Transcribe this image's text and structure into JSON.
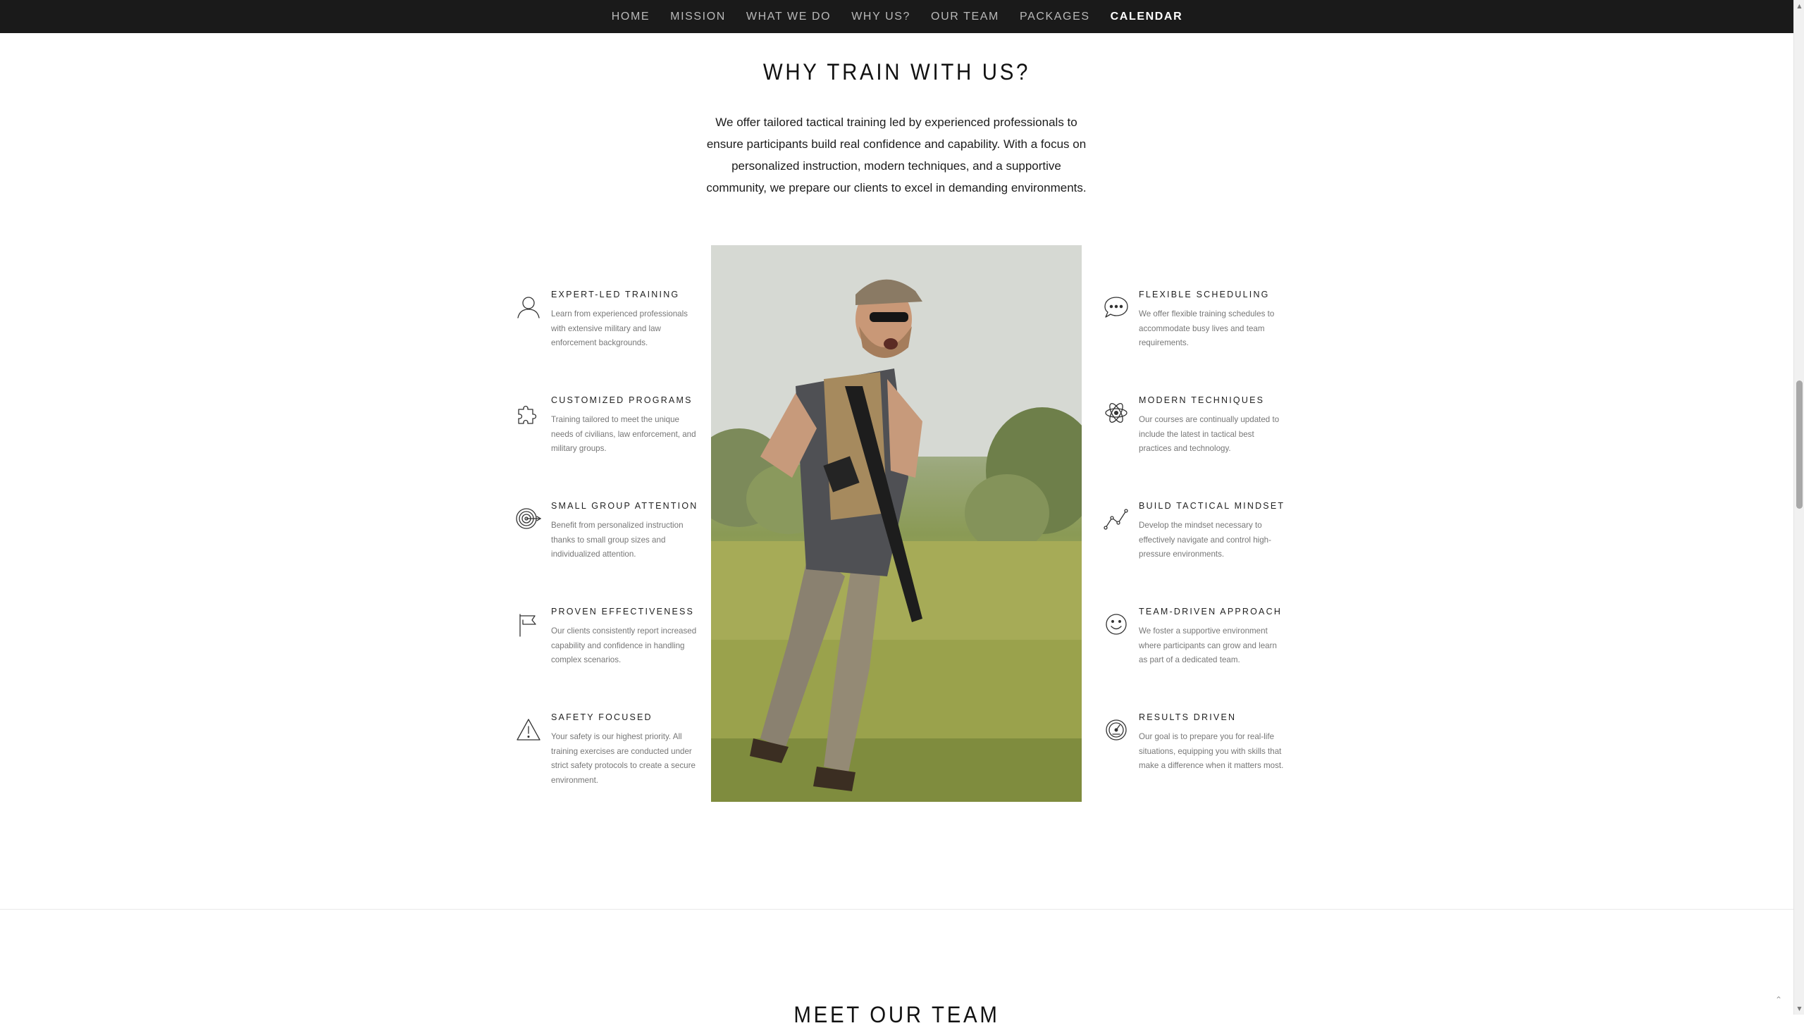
{
  "nav": {
    "items": [
      {
        "label": "HOME"
      },
      {
        "label": "MISSION"
      },
      {
        "label": "WHAT WE DO"
      },
      {
        "label": "WHY US?"
      },
      {
        "label": "OUR TEAM"
      },
      {
        "label": "PACKAGES"
      },
      {
        "label": "CALENDAR"
      }
    ],
    "active": "CALENDAR"
  },
  "why": {
    "title": "WHY TRAIN WITH US?",
    "intro": "We offer tailored tactical training led by experienced professionals to ensure participants build real confidence and capability. With a focus on personalized instruction, modern techniques, and a supportive community, we prepare our clients to excel in demanding environments."
  },
  "features_left": [
    {
      "icon": "user-icon",
      "title": "EXPERT-LED TRAINING",
      "text": "Learn from experienced professionals with extensive military and law enforcement backgrounds."
    },
    {
      "icon": "puzzle-icon",
      "title": "CUSTOMIZED PROGRAMS",
      "text": "Training tailored to meet the unique needs of civilians, law enforcement, and military groups."
    },
    {
      "icon": "target-icon",
      "title": "SMALL GROUP ATTENTION",
      "text": "Benefit from personalized instruction thanks to small group sizes and individualized attention."
    },
    {
      "icon": "flag-icon",
      "title": "PROVEN EFFECTIVENESS",
      "text": "Our clients consistently report increased capability and confidence in handling complex scenarios."
    },
    {
      "icon": "warning-icon",
      "title": "SAFETY FOCUSED",
      "text": "Your safety is our highest priority. All training exercises are conducted under strict safety protocols to create a secure environment."
    }
  ],
  "features_right": [
    {
      "icon": "chat-bubble-icon",
      "title": "FLEXIBLE SCHEDULING",
      "text": "We offer flexible training schedules to accommodate busy lives and team requirements."
    },
    {
      "icon": "atom-icon",
      "title": "MODERN TECHNIQUES",
      "text": "Our courses are continually updated to include the latest in tactical best practices and technology."
    },
    {
      "icon": "trend-line-icon",
      "title": "BUILD TACTICAL MINDSET",
      "text": "Develop the mindset necessary to effectively navigate and control high-pressure environments."
    },
    {
      "icon": "smiley-icon",
      "title": "TEAM-DRIVEN APPROACH",
      "text": "We foster a supportive environment where participants can grow and learn as part of a dedicated team."
    },
    {
      "icon": "speedometer-icon",
      "title": "RESULTS DRIVEN",
      "text": "Our goal is to prepare you for real-life situations, equipping you with skills that make a difference when it matters most."
    }
  ],
  "next_section": {
    "title": "MEET OUR TEAM"
  },
  "colors": {
    "nav_bg": "#1a1a1a",
    "nav_text": "#b9b9b9",
    "nav_active": "#ffffff",
    "title": "#111111",
    "body_text": "#1c1c1c",
    "muted_text": "#777777"
  }
}
